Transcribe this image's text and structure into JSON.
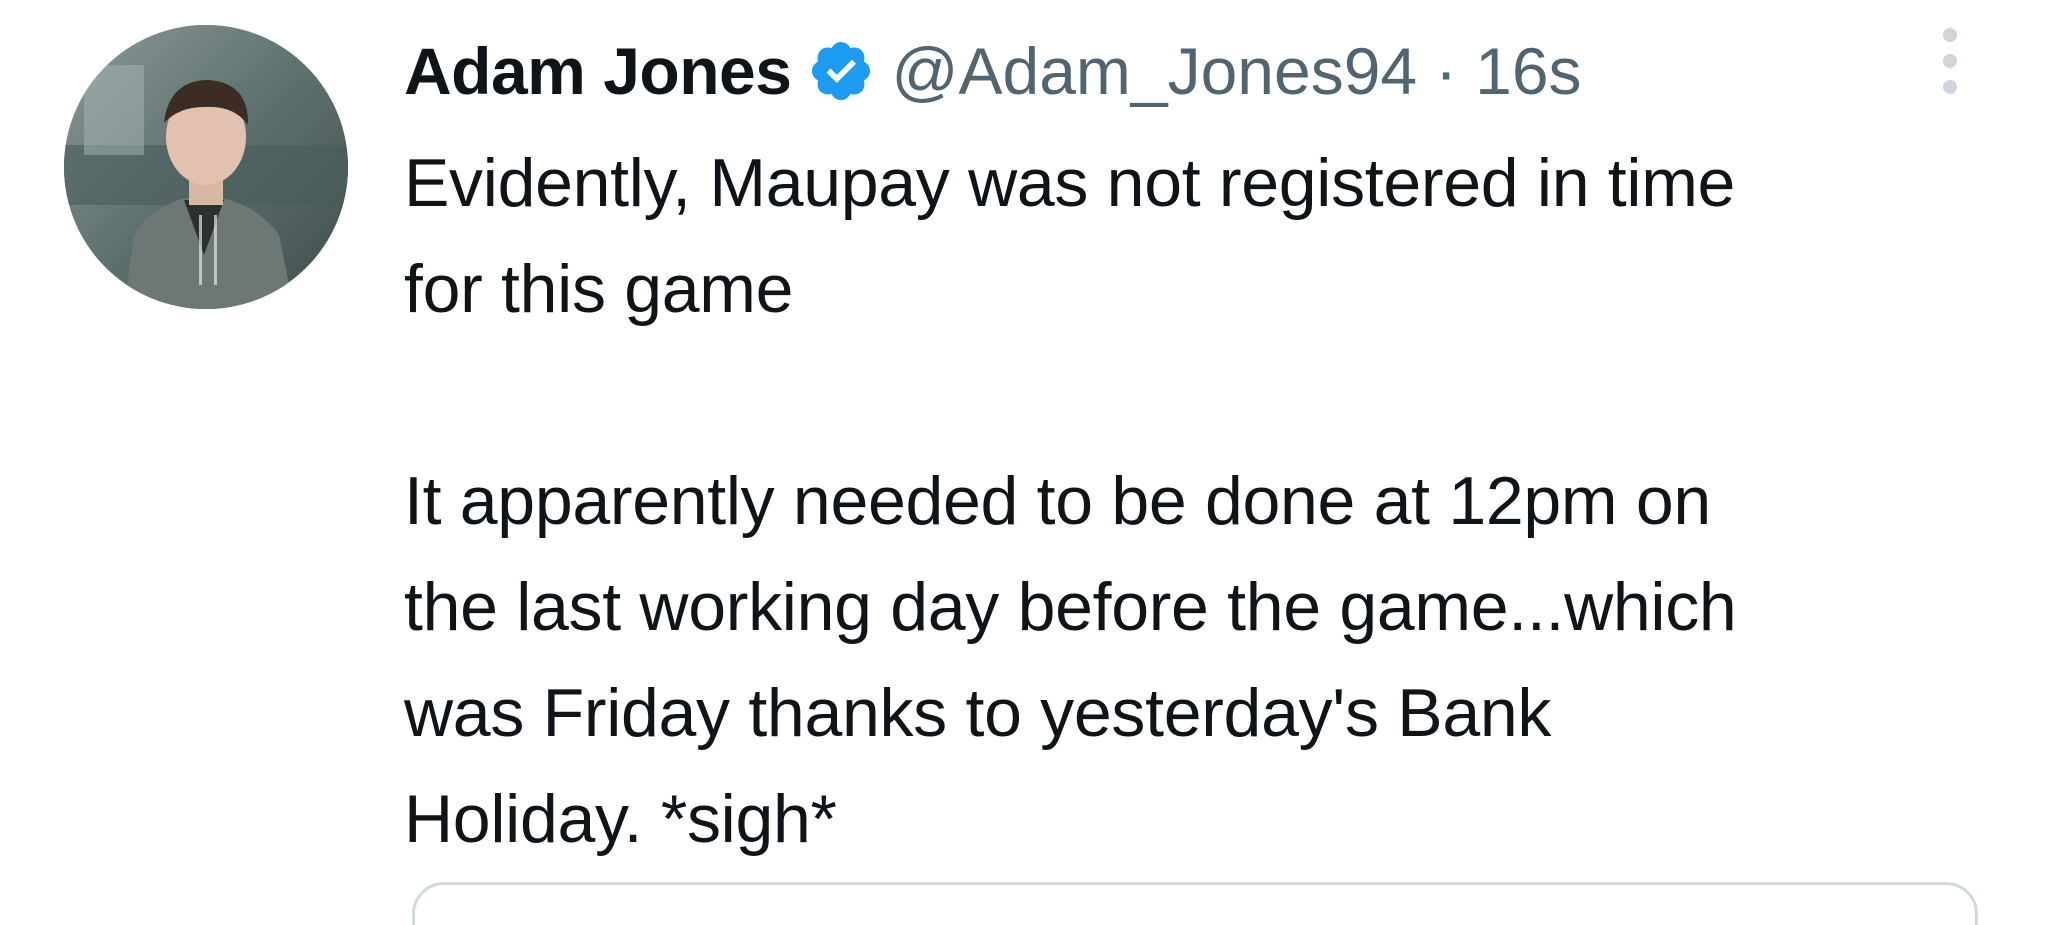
{
  "tweet": {
    "author_name": "Adam Jones",
    "verified_icon": "verified-badge-icon",
    "handle": "@Adam_Jones94",
    "separator": "·",
    "timestamp": "16s",
    "more_icon": "more-options-icon",
    "text": "Evidently, Maupay was not registered in time\nfor this game\n\nIt apparently needed to be done at 12pm on\nthe last working day before the game...which\nwas Friday thanks to yesterday's Bank\nHoliday. *sigh*"
  },
  "colors": {
    "verified_blue": "#1d9bf0",
    "secondary_text": "#536471",
    "primary_text": "#0f1419"
  }
}
